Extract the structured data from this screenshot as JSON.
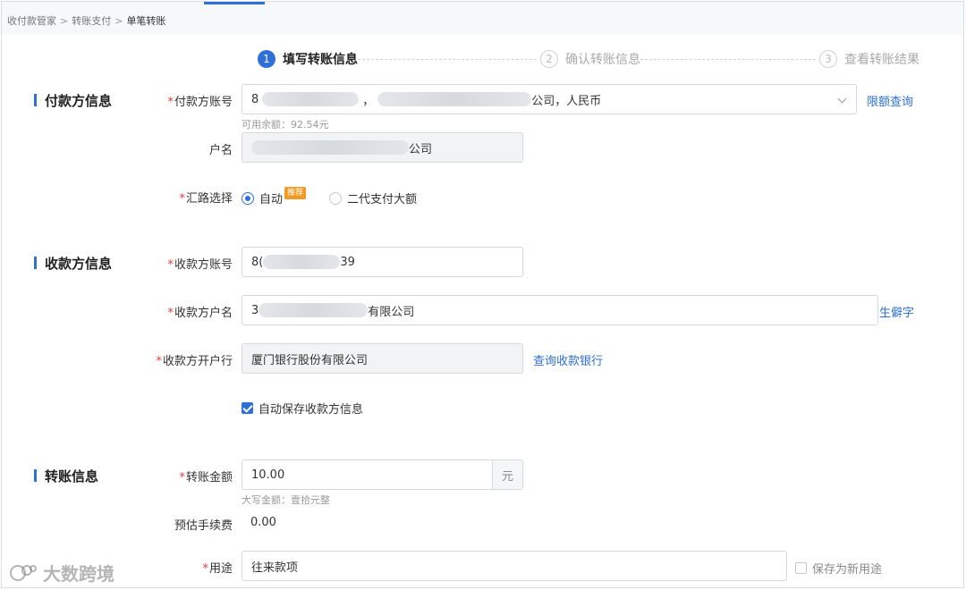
{
  "breadcrumb": [
    "收付款管家",
    "转账支付",
    "单笔转账"
  ],
  "steps": [
    {
      "num": "1",
      "label": "填写转账信息"
    },
    {
      "num": "2",
      "label": "确认转账信息"
    },
    {
      "num": "3",
      "label": "查看转账结果"
    }
  ],
  "payer": {
    "title": "付款方信息",
    "account_label": "付款方账号",
    "account_prefix": "8",
    "account_suffix": "公司，人民币",
    "account_sep": "，",
    "limit_link": "限额查询",
    "balance": "可用余额：92.54元",
    "name_label": "户名",
    "name_suffix": "公司",
    "route_label": "汇路选择",
    "route_options": [
      "自动",
      "二代支付大额"
    ],
    "recommend_badge": "推荐"
  },
  "payee": {
    "title": "收款方信息",
    "account_label": "收款方账号",
    "account_prefix": "8(",
    "account_suffix": "39",
    "name_label": "收款方户名",
    "name_prefix": "3",
    "name_suffix": "有限公司",
    "rare_char_link": "生僻字",
    "bank_label": "收款方开户行",
    "bank_value": "厦门银行股份有限公司",
    "bank_link": "查询收款银行",
    "auto_save_label": "自动保存收款方信息"
  },
  "transfer": {
    "title": "转账信息",
    "amount_label": "转账金额",
    "amount_value": "10.00",
    "amount_unit": "元",
    "amount_upper": "大写金额：壹拾元整",
    "fee_label": "预估手续费",
    "fee_value": "0.00",
    "purpose_label": "用途",
    "purpose_value": "往来款项",
    "save_purpose_label": "保存为新用途"
  },
  "required_mark": "*",
  "watermark": "大数跨境",
  "colors": {
    "accent": "#2f6fd8",
    "required": "#e53935",
    "badge": "#f39a24"
  }
}
